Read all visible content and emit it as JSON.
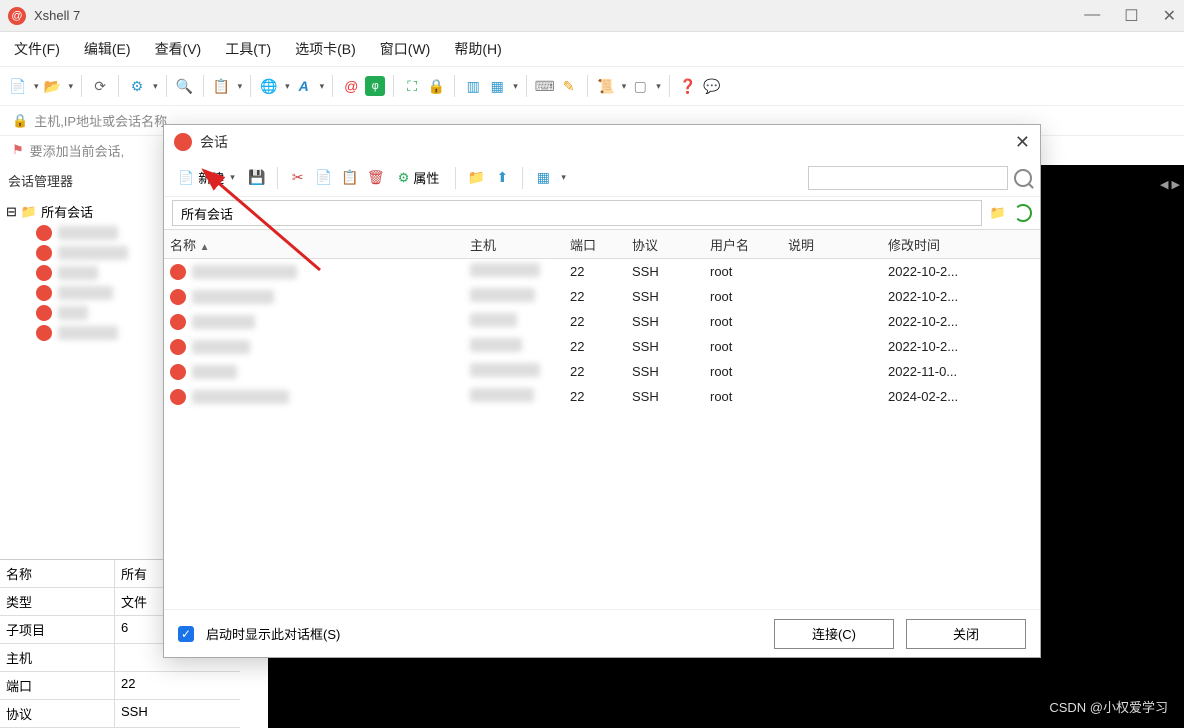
{
  "title": "Xshell 7",
  "menu": [
    "文件(F)",
    "编辑(E)",
    "查看(V)",
    "工具(T)",
    "选项卡(B)",
    "窗口(W)",
    "帮助(H)"
  ],
  "hostPlaceholder": "主机,IP地址或会话名称",
  "bookmarkHint": "要添加当前会话,",
  "sidebarTitle": "会话管理器",
  "treeRoot": "所有会话",
  "treeItems": [
    "█████",
    "██████",
    "███",
    "█████",
    "██",
    "████"
  ],
  "props": [
    {
      "label": "名称",
      "value": "所有"
    },
    {
      "label": "类型",
      "value": "文件"
    },
    {
      "label": "子项目",
      "value": "6"
    },
    {
      "label": "主机",
      "value": ""
    },
    {
      "label": "端口",
      "value": "22"
    },
    {
      "label": "协议",
      "value": "SSH"
    }
  ],
  "dialog": {
    "title": "会话",
    "newBtn": "新建",
    "propsBtn": "属性",
    "pathValue": "所有会话",
    "columns": {
      "name": "名称",
      "host": "主机",
      "port": "端口",
      "proto": "协议",
      "user": "用户名",
      "desc": "说明",
      "time": "修改时间"
    },
    "sortIndicator": "▲",
    "rows": [
      {
        "name": "████ ████",
        "host": "█████",
        "port": "22",
        "proto": "SSH",
        "user": "root",
        "desc": "",
        "time": "2022-10-2..."
      },
      {
        "name": "██████████",
        "host": "██████",
        "port": "22",
        "proto": "SSH",
        "user": "root",
        "desc": "",
        "time": "2022-10-2..."
      },
      {
        "name": "████",
        "host": "████...",
        "port": "22",
        "proto": "SSH",
        "user": "root",
        "desc": "",
        "time": "2022-10-2..."
      },
      {
        "name": "█████",
        "host": "████...",
        "port": "22",
        "proto": "SSH",
        "user": "root",
        "desc": "",
        "time": "2022-10-2..."
      },
      {
        "name": "██",
        "host": "██████",
        "port": "22",
        "proto": "SSH",
        "user": "root",
        "desc": "",
        "time": "2022-11-0..."
      },
      {
        "name": "███ ██████",
        "host": "████...",
        "port": "22",
        "proto": "SSH",
        "user": "root",
        "desc": "",
        "time": "2024-02-2..."
      }
    ],
    "showOnStart": "启动时显示此对话框(S)",
    "connectBtn": "连接(C)",
    "closeBtn": "关闭"
  },
  "watermark": "CSDN @小权爱学习"
}
